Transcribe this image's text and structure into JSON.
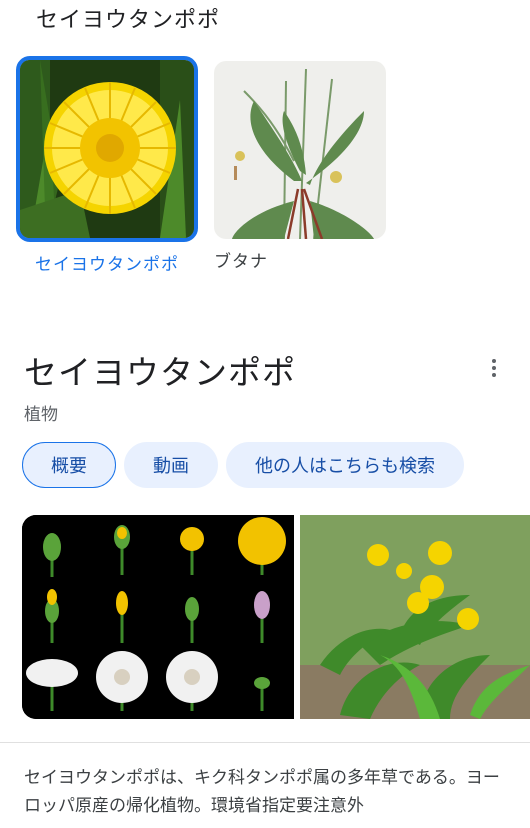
{
  "header": {
    "query_title": "セイヨウタンポポ"
  },
  "related": [
    {
      "label": "セイヨウタンポポ",
      "selected": true,
      "image": "dandelion-flower-photo"
    },
    {
      "label": "ブタナ",
      "selected": false,
      "image": "botanical-illustration"
    }
  ],
  "knowledge_panel": {
    "title": "セイヨウタンポポ",
    "subtitle": "植物",
    "more_icon": "more-vert-icon",
    "chips": [
      {
        "label": "概要",
        "active": true
      },
      {
        "label": "動画",
        "active": false
      },
      {
        "label": "他の人はこちらも検索",
        "active": false
      }
    ],
    "gallery": [
      "dandelion-growth-stages-photo",
      "dandelion-plants-field-photo"
    ],
    "description": "セイヨウタンポポは、キク科タンポポ属の多年草である。ヨーロッパ原産の帰化植物。環境省指定要注意外"
  },
  "colors": {
    "accent": "#1a73e8",
    "chip_bg": "#e8f0fe",
    "chip_text": "#174ea6"
  }
}
